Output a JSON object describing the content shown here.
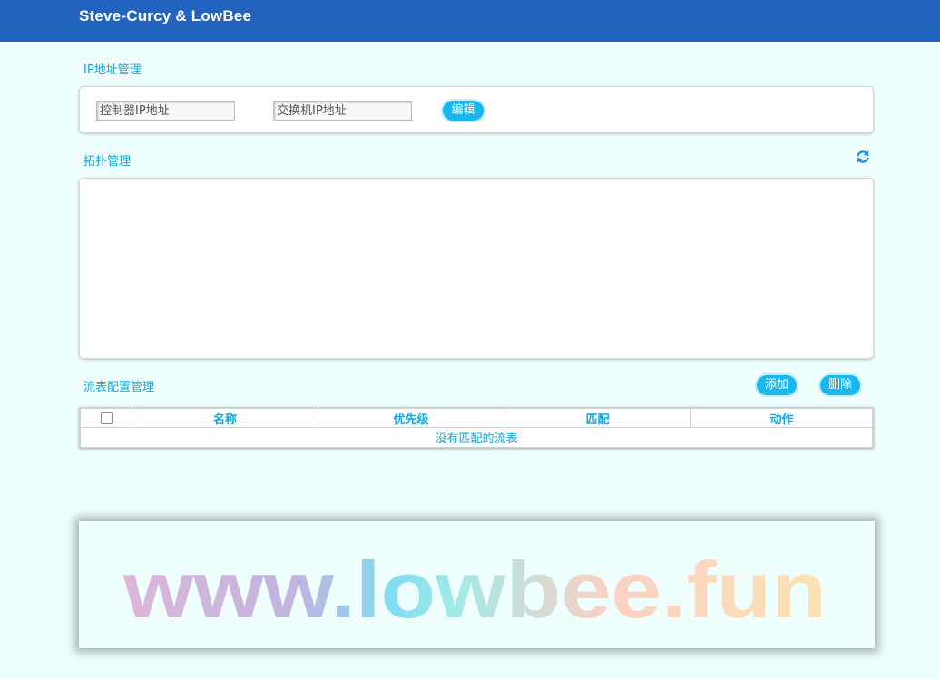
{
  "header": {
    "brand": "Steve-Curcy & LowBee"
  },
  "ip_section": {
    "title": "IP地址管理",
    "controller_placeholder": "控制器IP地址",
    "switch_placeholder": "交换机IP地址",
    "edit_label": "编辑"
  },
  "topology": {
    "title": "拓扑管理",
    "refresh_icon": "refresh-icon"
  },
  "flow_table": {
    "title": "流表配置管理",
    "add_label": "添加",
    "delete_label": "删除",
    "columns": [
      "名称",
      "优先级",
      "匹配",
      "动作"
    ],
    "empty_text": "没有匹配的流表"
  },
  "banner": {
    "text": "www.lowbee.fun",
    "gradient_colors": [
      "#dcb7d8",
      "#c0b4e1",
      "#82ddf0",
      "#a2eae8",
      "#fbd0c4",
      "#fbe3b4"
    ]
  },
  "colors": {
    "header_bg": "#2263bf",
    "accent": "#11a9d9",
    "button_bg": "#18b8ee",
    "page_bg": "#eefffe"
  }
}
